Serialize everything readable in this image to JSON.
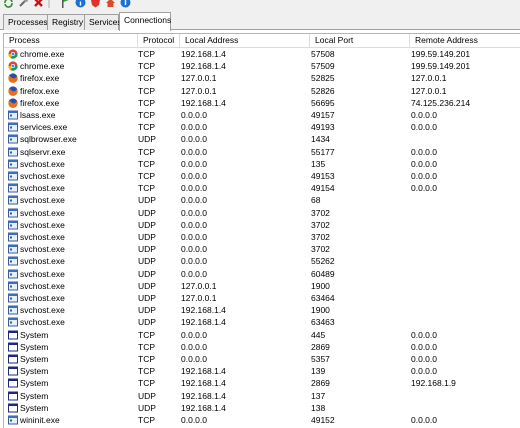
{
  "toolbar": {
    "buttons": [
      "refresh-icon",
      "tools-icon",
      "delete-icon",
      "separator",
      "flag-icon",
      "info-icon",
      "shield-icon",
      "web-icon",
      "help-icon"
    ]
  },
  "tabs": [
    "Processes",
    "Registry",
    "Services",
    "Connections"
  ],
  "active_tab": "Connections",
  "columns": [
    "Process",
    "Protocol",
    "Local Address",
    "Local Port",
    "Remote Address"
  ],
  "rows": [
    {
      "icon": "chrome-icon",
      "process": "chrome.exe",
      "protocol": "TCP",
      "local_address": "192.168.1.4",
      "local_port": "57508",
      "remote_address": "199.59.149.201"
    },
    {
      "icon": "chrome-icon",
      "process": "chrome.exe",
      "protocol": "TCP",
      "local_address": "192.168.1.4",
      "local_port": "57509",
      "remote_address": "199.59.149.201"
    },
    {
      "icon": "firefox-icon",
      "process": "firefox.exe",
      "protocol": "TCP",
      "local_address": "127.0.0.1",
      "local_port": "52825",
      "remote_address": "127.0.0.1"
    },
    {
      "icon": "firefox-icon",
      "process": "firefox.exe",
      "protocol": "TCP",
      "local_address": "127.0.0.1",
      "local_port": "52826",
      "remote_address": "127.0.0.1"
    },
    {
      "icon": "firefox-icon",
      "process": "firefox.exe",
      "protocol": "TCP",
      "local_address": "192.168.1.4",
      "local_port": "56695",
      "remote_address": "74.125.236.214"
    },
    {
      "icon": "service-icon",
      "process": "lsass.exe",
      "protocol": "TCP",
      "local_address": "0.0.0.0",
      "local_port": "49157",
      "remote_address": "0.0.0.0"
    },
    {
      "icon": "service-icon",
      "process": "services.exe",
      "protocol": "TCP",
      "local_address": "0.0.0.0",
      "local_port": "49193",
      "remote_address": "0.0.0.0"
    },
    {
      "icon": "service-icon",
      "process": "sqlbrowser.exe",
      "protocol": "UDP",
      "local_address": "0.0.0.0",
      "local_port": "1434",
      "remote_address": ""
    },
    {
      "icon": "service-icon",
      "process": "sqlservr.exe",
      "protocol": "TCP",
      "local_address": "0.0.0.0",
      "local_port": "55177",
      "remote_address": "0.0.0.0"
    },
    {
      "icon": "service-icon",
      "process": "svchost.exe",
      "protocol": "TCP",
      "local_address": "0.0.0.0",
      "local_port": "135",
      "remote_address": "0.0.0.0"
    },
    {
      "icon": "service-icon",
      "process": "svchost.exe",
      "protocol": "TCP",
      "local_address": "0.0.0.0",
      "local_port": "49153",
      "remote_address": "0.0.0.0"
    },
    {
      "icon": "service-icon",
      "process": "svchost.exe",
      "protocol": "TCP",
      "local_address": "0.0.0.0",
      "local_port": "49154",
      "remote_address": "0.0.0.0"
    },
    {
      "icon": "service-icon",
      "process": "svchost.exe",
      "protocol": "UDP",
      "local_address": "0.0.0.0",
      "local_port": "68",
      "remote_address": ""
    },
    {
      "icon": "service-icon",
      "process": "svchost.exe",
      "protocol": "UDP",
      "local_address": "0.0.0.0",
      "local_port": "3702",
      "remote_address": ""
    },
    {
      "icon": "service-icon",
      "process": "svchost.exe",
      "protocol": "UDP",
      "local_address": "0.0.0.0",
      "local_port": "3702",
      "remote_address": ""
    },
    {
      "icon": "service-icon",
      "process": "svchost.exe",
      "protocol": "UDP",
      "local_address": "0.0.0.0",
      "local_port": "3702",
      "remote_address": ""
    },
    {
      "icon": "service-icon",
      "process": "svchost.exe",
      "protocol": "UDP",
      "local_address": "0.0.0.0",
      "local_port": "3702",
      "remote_address": ""
    },
    {
      "icon": "service-icon",
      "process": "svchost.exe",
      "protocol": "UDP",
      "local_address": "0.0.0.0",
      "local_port": "55262",
      "remote_address": ""
    },
    {
      "icon": "service-icon",
      "process": "svchost.exe",
      "protocol": "UDP",
      "local_address": "0.0.0.0",
      "local_port": "60489",
      "remote_address": ""
    },
    {
      "icon": "service-icon",
      "process": "svchost.exe",
      "protocol": "UDP",
      "local_address": "127.0.0.1",
      "local_port": "1900",
      "remote_address": ""
    },
    {
      "icon": "service-icon",
      "process": "svchost.exe",
      "protocol": "UDP",
      "local_address": "127.0.0.1",
      "local_port": "63464",
      "remote_address": ""
    },
    {
      "icon": "service-icon",
      "process": "svchost.exe",
      "protocol": "UDP",
      "local_address": "192.168.1.4",
      "local_port": "1900",
      "remote_address": ""
    },
    {
      "icon": "service-icon",
      "process": "svchost.exe",
      "protocol": "UDP",
      "local_address": "192.168.1.4",
      "local_port": "63463",
      "remote_address": ""
    },
    {
      "icon": "window-icon",
      "process": "System",
      "protocol": "TCP",
      "local_address": "0.0.0.0",
      "local_port": "445",
      "remote_address": "0.0.0.0"
    },
    {
      "icon": "window-icon",
      "process": "System",
      "protocol": "TCP",
      "local_address": "0.0.0.0",
      "local_port": "2869",
      "remote_address": "0.0.0.0"
    },
    {
      "icon": "window-icon",
      "process": "System",
      "protocol": "TCP",
      "local_address": "0.0.0.0",
      "local_port": "5357",
      "remote_address": "0.0.0.0"
    },
    {
      "icon": "window-icon",
      "process": "System",
      "protocol": "TCP",
      "local_address": "192.168.1.4",
      "local_port": "139",
      "remote_address": "0.0.0.0"
    },
    {
      "icon": "window-icon",
      "process": "System",
      "protocol": "TCP",
      "local_address": "192.168.1.4",
      "local_port": "2869",
      "remote_address": "192.168.1.9"
    },
    {
      "icon": "window-icon",
      "process": "System",
      "protocol": "UDP",
      "local_address": "192.168.1.4",
      "local_port": "137",
      "remote_address": ""
    },
    {
      "icon": "window-icon",
      "process": "System",
      "protocol": "UDP",
      "local_address": "192.168.1.4",
      "local_port": "138",
      "remote_address": ""
    },
    {
      "icon": "service-icon",
      "process": "wininit.exe",
      "protocol": "TCP",
      "local_address": "0.0.0.0",
      "local_port": "49152",
      "remote_address": "0.0.0.0"
    }
  ]
}
